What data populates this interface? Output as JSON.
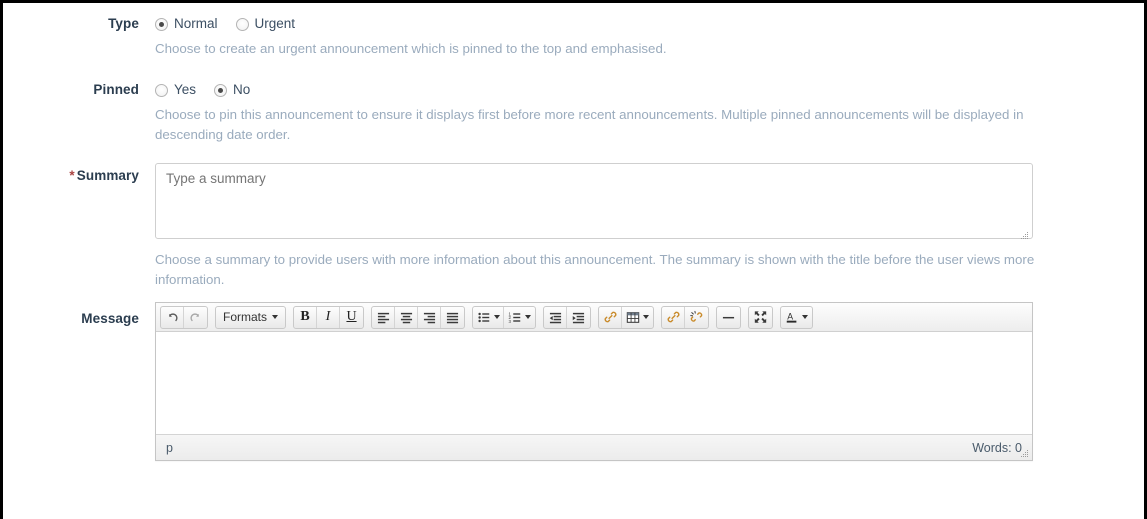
{
  "form": {
    "rows": [
      {
        "label": "Type",
        "required": false,
        "options": [
          {
            "label": "Normal",
            "checked": true
          },
          {
            "label": "Urgent",
            "checked": false
          }
        ],
        "help": "Choose to create an urgent announcement which is pinned to the top and emphasised."
      },
      {
        "label": "Pinned",
        "required": false,
        "options": [
          {
            "label": "Yes",
            "checked": false
          },
          {
            "label": "No",
            "checked": true
          }
        ],
        "help": "Choose to pin this announcement to ensure it displays first before more recent announcements. Multiple pinned announcements will be displayed in descending date order."
      }
    ],
    "summary": {
      "label": "Summary",
      "required_marker": "*",
      "value": "",
      "placeholder": "Type a summary",
      "help": "Choose a summary to provide users with more information about this announcement. The summary is shown with the title before the user views more information."
    },
    "message": {
      "label": "Message",
      "body_value": "",
      "status_path": "p",
      "word_count_label": "Words: 0"
    }
  },
  "editor_toolbar": {
    "groups": [
      {
        "name": "history",
        "buttons": [
          {
            "name": "undo-icon",
            "glyph": "↶",
            "label": "Undo"
          },
          {
            "name": "redo-icon",
            "glyph": "↷",
            "label": "Redo"
          }
        ]
      },
      {
        "name": "formats",
        "buttons": [
          {
            "name": "formats-dropdown",
            "glyph": "",
            "label": "Formats",
            "has_caret": true
          }
        ]
      },
      {
        "name": "inline-style",
        "buttons": [
          {
            "name": "bold-icon",
            "glyph": "B",
            "label": "Bold"
          },
          {
            "name": "italic-icon",
            "glyph": "I",
            "label": "Italic"
          },
          {
            "name": "underline-icon",
            "glyph": "U",
            "label": "Underline"
          }
        ]
      },
      {
        "name": "alignment",
        "buttons": [
          {
            "name": "align-left-icon",
            "glyph": "",
            "label": "Align left"
          },
          {
            "name": "align-center-icon",
            "glyph": "",
            "label": "Align center"
          },
          {
            "name": "align-right-icon",
            "glyph": "",
            "label": "Align right"
          },
          {
            "name": "align-justify-icon",
            "glyph": "",
            "label": "Justify"
          }
        ]
      },
      {
        "name": "lists",
        "buttons": [
          {
            "name": "bullet-list-icon",
            "glyph": "",
            "label": "Bullet list",
            "has_caret": true
          },
          {
            "name": "numbered-list-icon",
            "glyph": "",
            "label": "Numbered list",
            "has_caret": true
          }
        ]
      },
      {
        "name": "indentation",
        "buttons": [
          {
            "name": "outdent-icon",
            "glyph": "",
            "label": "Decrease indent"
          },
          {
            "name": "indent-icon",
            "glyph": "",
            "label": "Increase indent"
          }
        ]
      },
      {
        "name": "insert",
        "buttons": [
          {
            "name": "link-icon",
            "glyph": "",
            "label": "Insert link"
          },
          {
            "name": "table-icon",
            "glyph": "",
            "label": "Table",
            "has_caret": true
          }
        ]
      },
      {
        "name": "link-tools",
        "buttons": [
          {
            "name": "insert-link-icon",
            "glyph": "",
            "label": "Insert/edit link"
          },
          {
            "name": "unlink-icon",
            "glyph": "",
            "label": "Remove link"
          }
        ]
      },
      {
        "name": "horizontal-rule",
        "buttons": [
          {
            "name": "horizontal-rule-icon",
            "glyph": "—",
            "label": "Horizontal line"
          }
        ]
      },
      {
        "name": "fullscreen",
        "buttons": [
          {
            "name": "fullscreen-icon",
            "glyph": "",
            "label": "Fullscreen"
          }
        ]
      },
      {
        "name": "text-color",
        "buttons": [
          {
            "name": "text-color-icon",
            "glyph": "A",
            "label": "Text color",
            "has_caret": true
          }
        ]
      }
    ]
  },
  "colors": {
    "label_text": "#2b3d4f",
    "help_text": "#9aabbd",
    "required_asterisk": "#a94442",
    "field_border": "#cfcfcf",
    "toolbar_icon": "#333333"
  }
}
